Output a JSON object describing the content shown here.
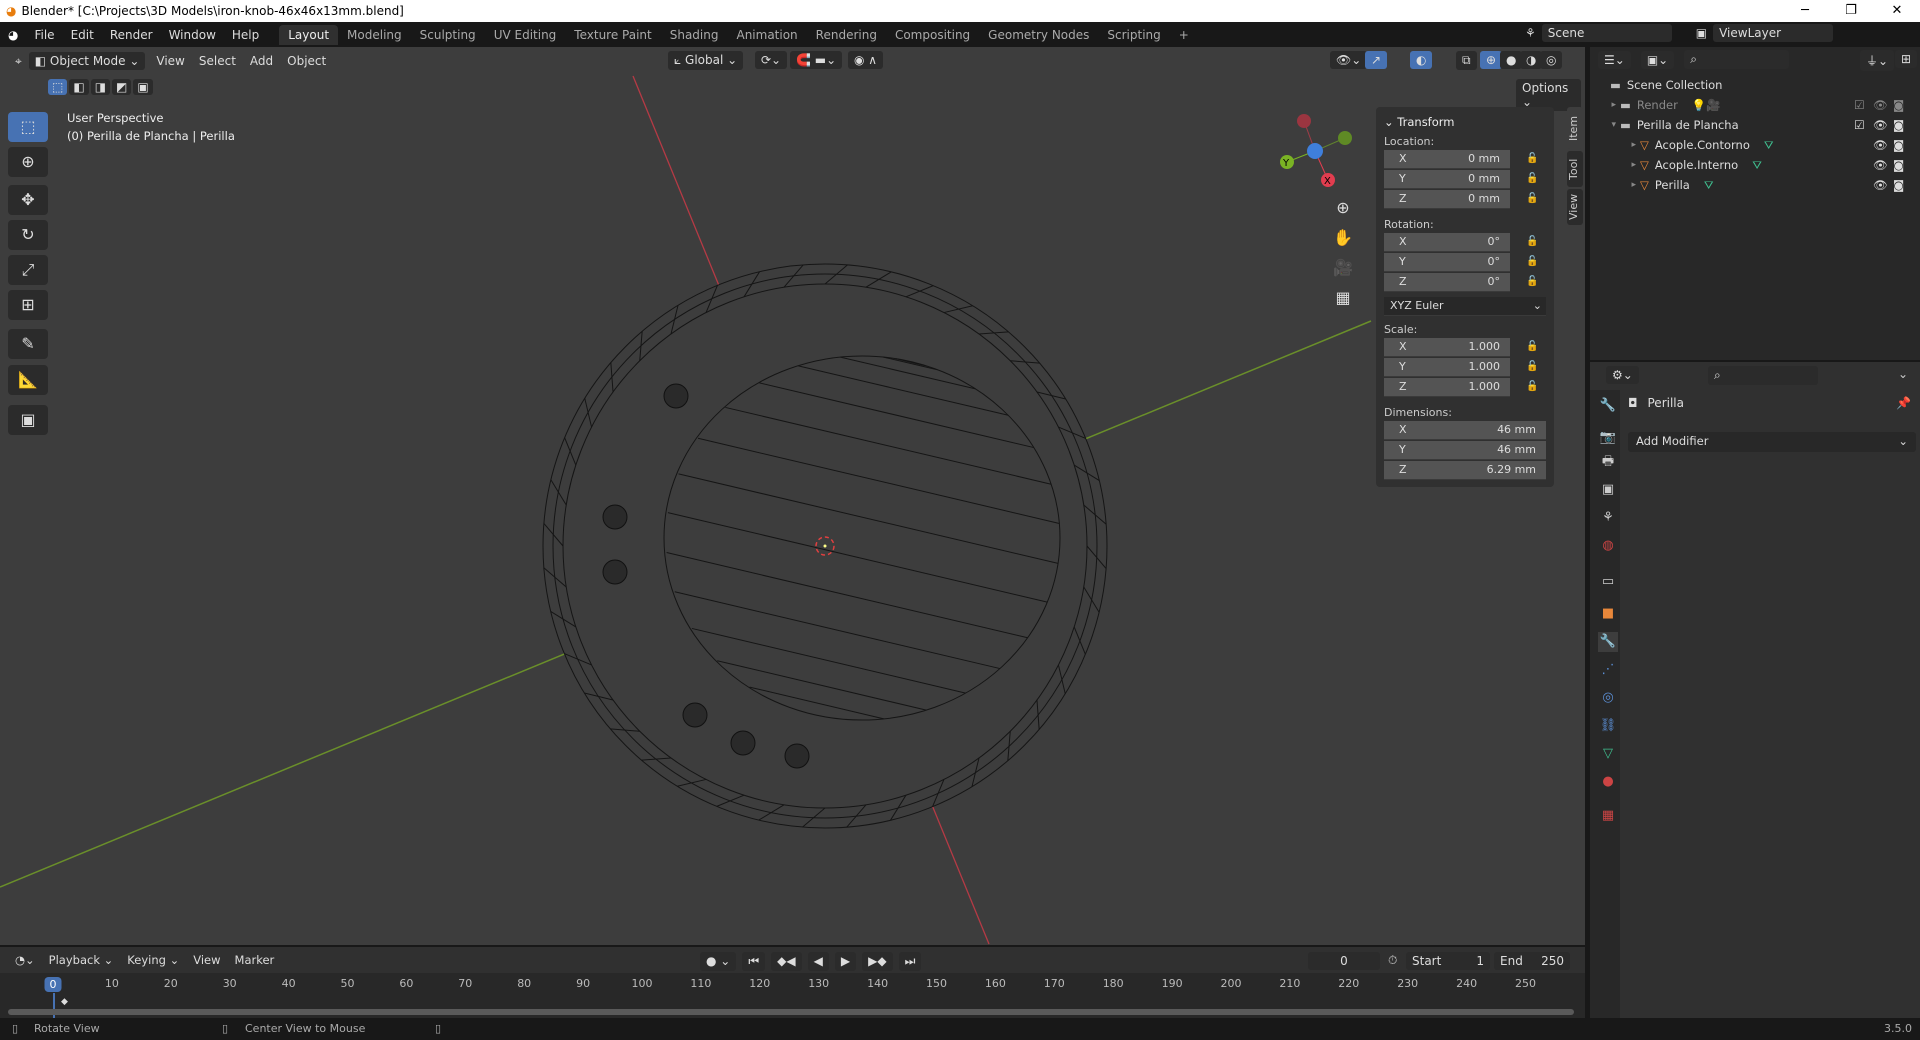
{
  "window": {
    "title": "Blender* [C:\\Projects\\3D Models\\iron-knob-46x46x13mm.blend]",
    "minimize": "─",
    "restore": "❐",
    "close": "✕"
  },
  "menu": [
    "File",
    "Edit",
    "Render",
    "Window",
    "Help"
  ],
  "workspaces": [
    "Layout",
    "Modeling",
    "Sculpting",
    "UV Editing",
    "Texture Paint",
    "Shading",
    "Animation",
    "Rendering",
    "Compositing",
    "Geometry Nodes",
    "Scripting",
    "+"
  ],
  "active_workspace": "Layout",
  "scene": {
    "name": "Scene",
    "view_layer": "ViewLayer"
  },
  "viewport": {
    "mode": "Object Mode",
    "menus": [
      "View",
      "Select",
      "Add",
      "Object"
    ],
    "orientation": "Global",
    "options": "Options",
    "overlay_title": "User Perspective",
    "overlay_sub": "(0) Perilla de Plancha | Perilla",
    "gizmo": {
      "x": "X",
      "y": "Y",
      "x_color": "#e23d4f",
      "y_color": "#7ab324",
      "z_color": "#3f7fdb"
    },
    "axis_colors": {
      "x": "#b53a45",
      "y": "#6a8f2a"
    }
  },
  "npanel": {
    "tabs": [
      "Item",
      "Tool",
      "View"
    ],
    "title": "Transform",
    "location_label": "Location:",
    "location": [
      [
        "X",
        "0 mm"
      ],
      [
        "Y",
        "0 mm"
      ],
      [
        "Z",
        "0 mm"
      ]
    ],
    "rotation_label": "Rotation:",
    "rotation": [
      [
        "X",
        "0°"
      ],
      [
        "Y",
        "0°"
      ],
      [
        "Z",
        "0°"
      ]
    ],
    "rotation_mode": "XYZ Euler",
    "scale_label": "Scale:",
    "scale": [
      [
        "X",
        "1.000"
      ],
      [
        "Y",
        "1.000"
      ],
      [
        "Z",
        "1.000"
      ]
    ],
    "dimensions_label": "Dimensions:",
    "dimensions": [
      [
        "X",
        "46 mm"
      ],
      [
        "Y",
        "46 mm"
      ],
      [
        "Z",
        "6.29 mm"
      ]
    ]
  },
  "outliner": {
    "root": "Scene Collection",
    "items": [
      {
        "name": "Render",
        "type": "collection",
        "dimmed": true
      },
      {
        "name": "Perilla de Plancha",
        "type": "collection"
      },
      {
        "name": "Acople.Contorno",
        "type": "mesh"
      },
      {
        "name": "Acople.Interno",
        "type": "mesh"
      },
      {
        "name": "Perilla",
        "type": "mesh"
      }
    ]
  },
  "properties": {
    "object": "Perilla",
    "add_modifier": "Add Modifier"
  },
  "timeline": {
    "menus": [
      "Playback",
      "Keying",
      "View",
      "Marker"
    ],
    "current_frame": "0",
    "start_label": "Start",
    "start": "1",
    "end_label": "End",
    "end": "250",
    "ticks": [
      "0",
      "10",
      "20",
      "30",
      "40",
      "50",
      "60",
      "70",
      "80",
      "90",
      "100",
      "110",
      "120",
      "130",
      "140",
      "150",
      "160",
      "170",
      "180",
      "190",
      "200",
      "210",
      "220",
      "230",
      "240",
      "250"
    ]
  },
  "status": {
    "left": "Rotate View",
    "middle": "Center View to Mouse",
    "version": "3.5.0"
  }
}
